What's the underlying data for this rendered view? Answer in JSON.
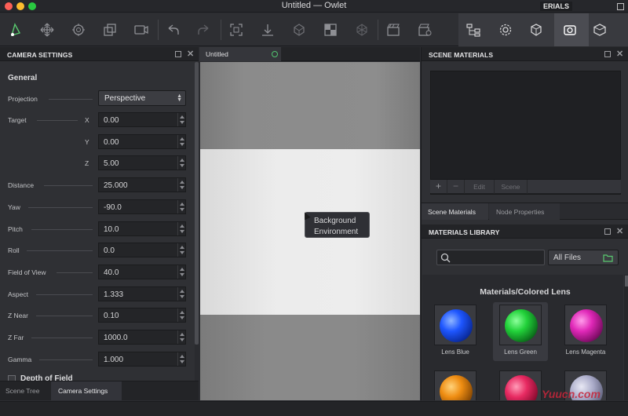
{
  "window": {
    "title": "Untitled — Owlet",
    "floating_label": "ERIALS"
  },
  "camera_settings": {
    "header": "CAMERA SETTINGS",
    "section": "General",
    "projection": {
      "label": "Projection",
      "value": "Perspective"
    },
    "target": {
      "label": "Target",
      "x_label": "X",
      "x": "0.00",
      "y_label": "Y",
      "y": "0.00",
      "z_label": "Z",
      "z": "5.00"
    },
    "fields": [
      {
        "label": "Distance",
        "value": "25.000"
      },
      {
        "label": "Yaw",
        "value": "-90.0"
      },
      {
        "label": "Pitch",
        "value": "10.0"
      },
      {
        "label": "Roll",
        "value": "0.0"
      },
      {
        "label": "Field of View",
        "value": "40.0"
      },
      {
        "label": "Aspect",
        "value": "1.333"
      },
      {
        "label": "Z Near",
        "value": "0.10"
      },
      {
        "label": "Z Far",
        "value": "1000.0"
      },
      {
        "label": "Gamma",
        "value": "1.000"
      }
    ],
    "depth_of_field": "Depth of Field"
  },
  "bottom_tabs": {
    "scene_tree": "Scene Tree",
    "camera_settings": "Camera Settings"
  },
  "viewport": {
    "tab": "Untitled",
    "tooltip_line1": "Background",
    "tooltip_line2": "Environment"
  },
  "scene_materials": {
    "header": "SCENE MATERIALS",
    "footer": {
      "add": "+",
      "remove": "−",
      "edit": "Edit",
      "scene": "Scene"
    },
    "tabs": {
      "scene_materials": "Scene Materials",
      "node_properties": "Node Properties"
    }
  },
  "materials_library": {
    "header": "MATERIALS LIBRARY",
    "search_placeholder": "",
    "filter": "All Files",
    "category": "Materials/Colored Lens",
    "items": [
      {
        "name": "Lens Blue",
        "color": "#1e56ff"
      },
      {
        "name": "Lens Green",
        "color": "#22d23a"
      },
      {
        "name": "Lens Magenta",
        "color": "#e028b8"
      },
      {
        "name": "",
        "color": "#ef8d12"
      },
      {
        "name": "",
        "color": "#e82a62"
      },
      {
        "name": "",
        "color": "#a9aac8"
      }
    ]
  },
  "watermark": "Yuucn.com"
}
